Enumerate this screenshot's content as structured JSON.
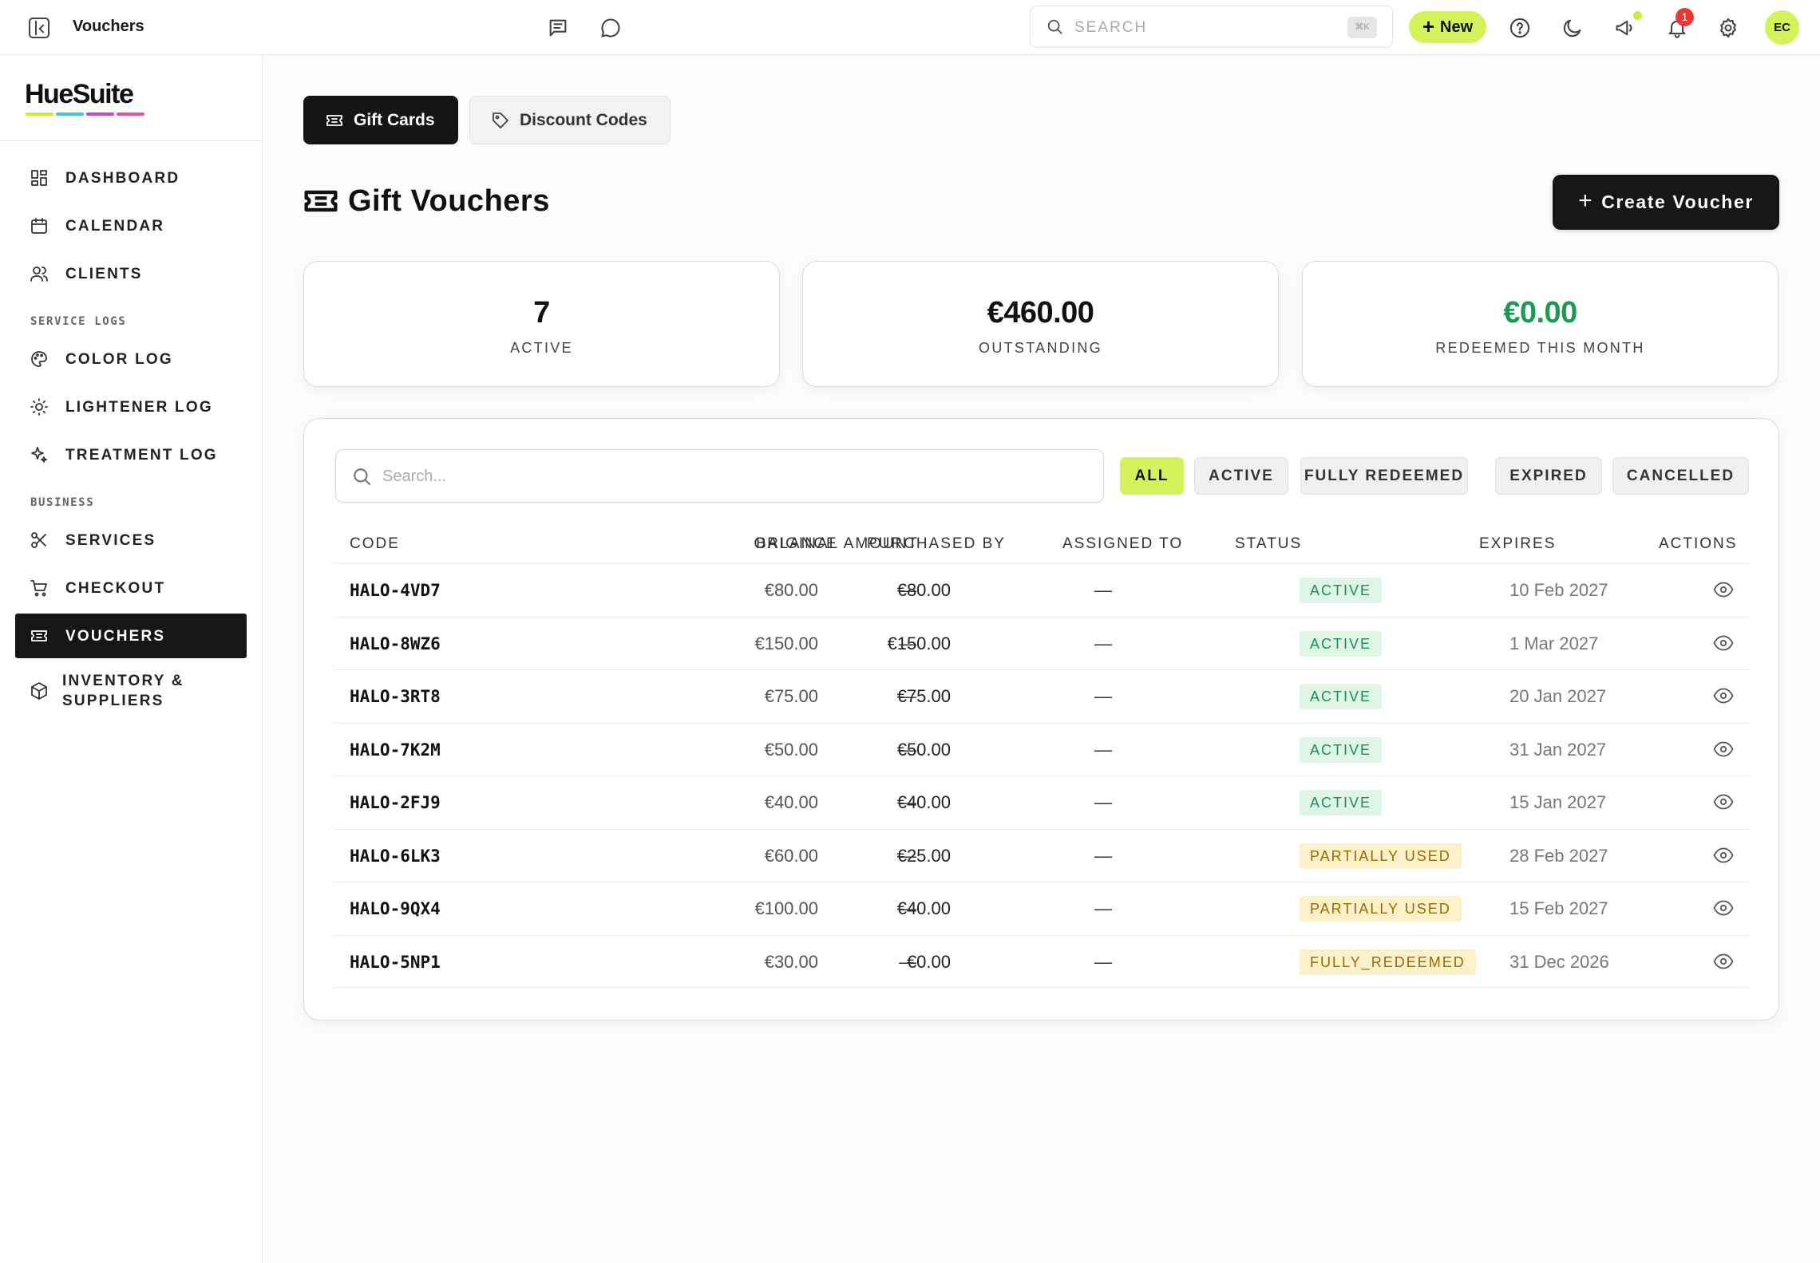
{
  "header": {
    "title": "Vouchers",
    "search_placeholder": "SEARCH",
    "search_shortcut": "⌘K",
    "new_label": "New",
    "notification_count": "1",
    "avatar_initials": "EC"
  },
  "brand": {
    "name": "HueSuite",
    "bar_colors": [
      "#c8ee3c",
      "#3fc8e8",
      "#c04ad8",
      "#e04fb0"
    ]
  },
  "sidebar": {
    "items_top": [
      {
        "label": "DASHBOARD",
        "icon": "grid-icon"
      },
      {
        "label": "CALENDAR",
        "icon": "calendar-icon"
      },
      {
        "label": "CLIENTS",
        "icon": "users-icon"
      }
    ],
    "section_service": "SERVICE LOGS",
    "items_service": [
      {
        "label": "COLOR LOG",
        "icon": "palette-icon"
      },
      {
        "label": "LIGHTENER LOG",
        "icon": "sun-icon"
      },
      {
        "label": "TREATMENT LOG",
        "icon": "sparkles-icon"
      }
    ],
    "section_business": "BUSINESS",
    "items_business": [
      {
        "label": "SERVICES",
        "icon": "scissors-icon"
      },
      {
        "label": "CHECKOUT",
        "icon": "cart-icon"
      },
      {
        "label": "VOUCHERS",
        "icon": "ticket-icon",
        "active": true
      },
      {
        "label_line1": "INVENTORY &",
        "label_line2": "SUPPLIERS",
        "icon": "box-icon"
      }
    ]
  },
  "tabs": {
    "gift_cards": "Gift Cards",
    "discount_codes": "Discount Codes"
  },
  "page": {
    "title": "Gift Vouchers",
    "create_label": "Create Voucher"
  },
  "stats": [
    {
      "value": "7",
      "label": "ACTIVE",
      "color": "#111111"
    },
    {
      "value": "€460.00",
      "label": "OUTSTANDING",
      "color": "#111111"
    },
    {
      "value": "€0.00",
      "label": "REDEEMED THIS MONTH",
      "color": "#1a9a55"
    }
  ],
  "table": {
    "search_placeholder": "Search...",
    "filters": [
      "ALL",
      "ACTIVE",
      "FULLY REDEEMED",
      "EXPIRED",
      "CANCELLED"
    ],
    "active_filter": "ALL",
    "columns": {
      "code": "CODE",
      "original": "ORIGINAL AMOUNT",
      "balance": "BALANCE",
      "purchased_by": "PURCHASED BY",
      "assigned_to": "ASSIGNED TO",
      "status": "STATUS",
      "expires": "EXPIRES",
      "actions": "ACTIONS"
    },
    "rows": [
      {
        "code": "HALO-4VD7",
        "original": "€80.00",
        "balance": "€80.00",
        "purchased_by": "—",
        "assigned_to": "—",
        "status": "ACTIVE",
        "status_kind": "active",
        "expires": "10 Feb 2027"
      },
      {
        "code": "HALO-8WZ6",
        "original": "€150.00",
        "balance": "€150.00",
        "purchased_by": "—",
        "assigned_to": "—",
        "status": "ACTIVE",
        "status_kind": "active",
        "expires": "1 Mar 2027"
      },
      {
        "code": "HALO-3RT8",
        "original": "€75.00",
        "balance": "€75.00",
        "purchased_by": "—",
        "assigned_to": "—",
        "status": "ACTIVE",
        "status_kind": "active",
        "expires": "20 Jan 2027"
      },
      {
        "code": "HALO-7K2M",
        "original": "€50.00",
        "balance": "€50.00",
        "purchased_by": "—",
        "assigned_to": "—",
        "status": "ACTIVE",
        "status_kind": "active",
        "expires": "31 Jan 2027"
      },
      {
        "code": "HALO-2FJ9",
        "original": "€40.00",
        "balance": "€40.00",
        "purchased_by": "—",
        "assigned_to": "—",
        "status": "ACTIVE",
        "status_kind": "active",
        "expires": "15 Jan 2027"
      },
      {
        "code": "HALO-6LK3",
        "original": "€60.00",
        "balance": "€25.00",
        "purchased_by": "—",
        "assigned_to": "—",
        "status": "PARTIALLY USED",
        "status_kind": "partial",
        "expires": "28 Feb 2027"
      },
      {
        "code": "HALO-9QX4",
        "original": "€100.00",
        "balance": "€40.00",
        "purchased_by": "—",
        "assigned_to": "—",
        "status": "PARTIALLY USED",
        "status_kind": "partial",
        "expires": "15 Feb 2027"
      },
      {
        "code": "HALO-5NP1",
        "original": "€30.00",
        "balance": "€0.00",
        "purchased_by": "—",
        "assigned_to": "—",
        "status": "FULLY_REDEEMED",
        "status_kind": "full",
        "expires": "31 Dec 2026"
      }
    ]
  }
}
